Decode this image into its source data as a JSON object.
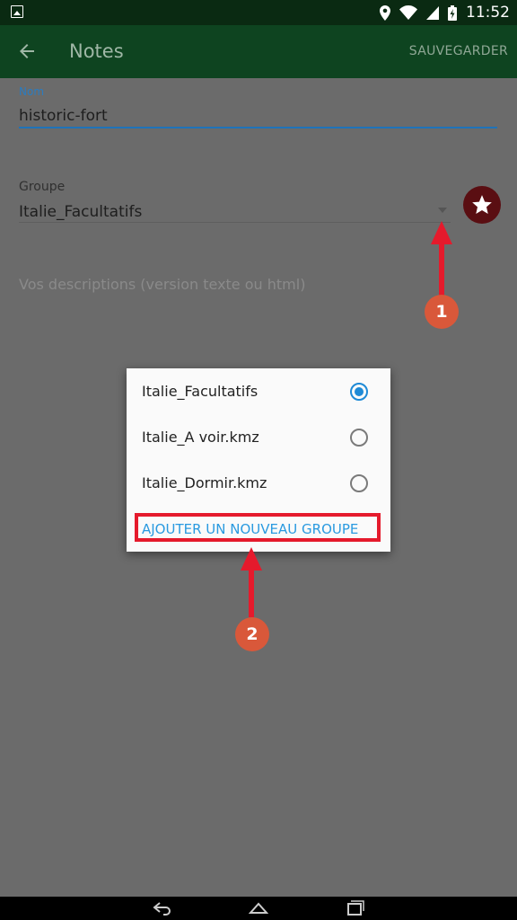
{
  "status_bar": {
    "time": "11:52"
  },
  "app_bar": {
    "title": "Notes",
    "save_label": "SAUVEGARDER"
  },
  "form": {
    "nom": {
      "label": "Nom",
      "value": "historic-fort"
    },
    "groupe": {
      "label": "Groupe",
      "value": "Italie_Facultatifs"
    },
    "description": {
      "placeholder": "Vos descriptions (version texte ou html)"
    }
  },
  "dialog": {
    "options": [
      {
        "label": "Italie_Facultatifs",
        "selected": true
      },
      {
        "label": "Italie_A voir.kmz",
        "selected": false
      },
      {
        "label": "Italie_Dormir.kmz",
        "selected": false
      }
    ],
    "add_group_label": "AJOUTER UN NOUVEAU GROUPE"
  },
  "annotations": {
    "step1": "1",
    "step2": "2"
  },
  "colors": {
    "app_bar": "#0e4420",
    "accent": "#1e8ad6",
    "highlight": "#e51a2c",
    "badge": "#d9583a",
    "favorite": "#5a0e12"
  }
}
